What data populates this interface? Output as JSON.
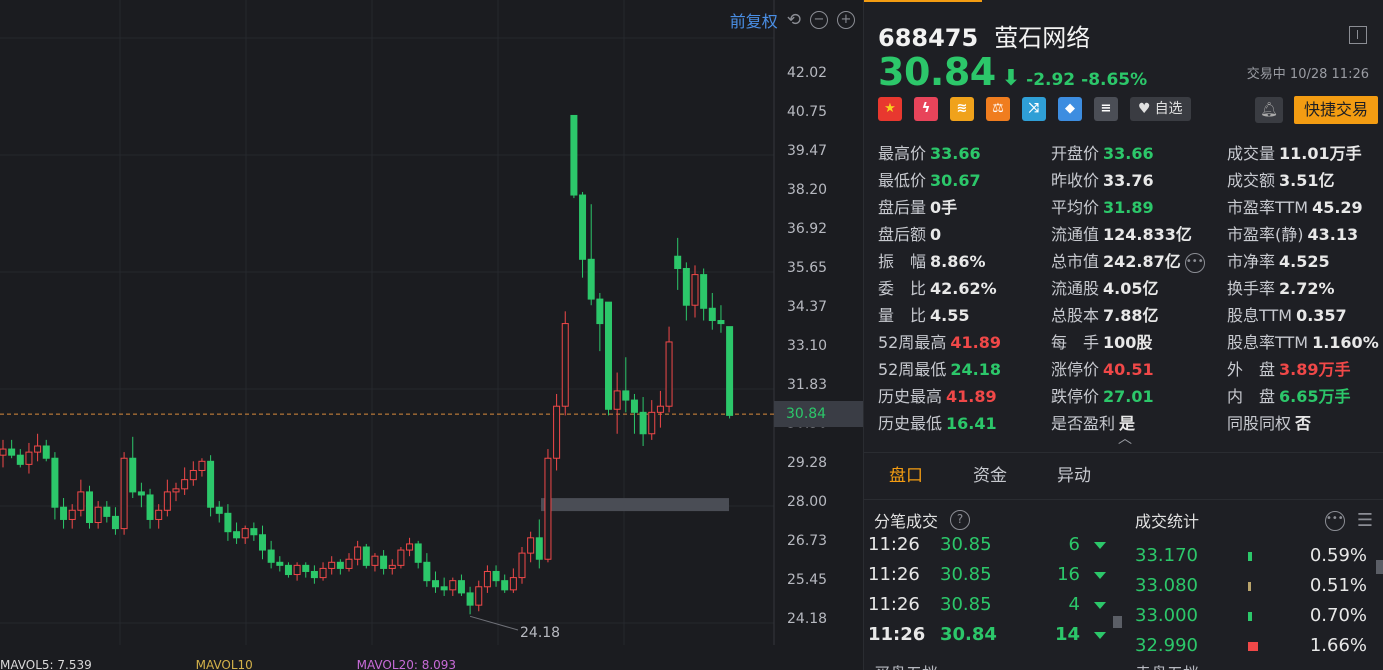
{
  "chart_toolbar": {
    "adjust_label": "前复权",
    "undo_glyph": "⟲",
    "zoom_out_glyph": "−",
    "zoom_in_glyph": "+"
  },
  "chart_data": {
    "type": "candlestick",
    "y_ticks": [
      "42.02",
      "40.75",
      "39.47",
      "38.20",
      "36.92",
      "35.65",
      "34.37",
      "33.10",
      "31.83",
      "30.56",
      "29.28",
      "28.00",
      "26.73",
      "25.45",
      "24.18"
    ],
    "ylim": [
      24.18,
      42.02
    ],
    "current_price": "30.84",
    "low_annotation": "24.18",
    "candles": [
      [
        29.5,
        30.0,
        29.1,
        29.7
      ],
      [
        29.7,
        30.0,
        29.4,
        29.5
      ],
      [
        29.5,
        29.7,
        29.1,
        29.2
      ],
      [
        29.2,
        29.9,
        28.9,
        29.6
      ],
      [
        29.6,
        30.2,
        29.3,
        29.8
      ],
      [
        29.8,
        30.0,
        29.3,
        29.4
      ],
      [
        29.4,
        29.6,
        27.4,
        27.8
      ],
      [
        27.8,
        28.1,
        27.1,
        27.4
      ],
      [
        27.4,
        27.9,
        27.1,
        27.7
      ],
      [
        27.7,
        28.7,
        27.5,
        28.3
      ],
      [
        28.3,
        28.5,
        27.1,
        27.3
      ],
      [
        27.3,
        28.0,
        27.1,
        27.8
      ],
      [
        27.8,
        28.0,
        27.3,
        27.5
      ],
      [
        27.5,
        27.8,
        26.9,
        27.1
      ],
      [
        27.1,
        29.6,
        26.9,
        29.4
      ],
      [
        29.4,
        30.1,
        28.1,
        28.3
      ],
      [
        28.3,
        28.6,
        27.8,
        28.2
      ],
      [
        28.2,
        28.4,
        27.1,
        27.4
      ],
      [
        27.4,
        27.9,
        27.1,
        27.7
      ],
      [
        27.7,
        28.7,
        27.5,
        28.3
      ],
      [
        28.3,
        28.6,
        28.0,
        28.4
      ],
      [
        28.4,
        29.1,
        28.2,
        28.7
      ],
      [
        28.7,
        29.3,
        28.5,
        29.0
      ],
      [
        29.0,
        29.4,
        28.8,
        29.3
      ],
      [
        29.3,
        29.5,
        27.5,
        27.8
      ],
      [
        27.8,
        28.0,
        27.3,
        27.6
      ],
      [
        27.6,
        27.9,
        26.7,
        27.0
      ],
      [
        27.0,
        27.3,
        26.6,
        26.8
      ],
      [
        26.8,
        27.2,
        26.6,
        27.1
      ],
      [
        27.1,
        27.3,
        26.7,
        26.9
      ],
      [
        26.9,
        27.2,
        26.1,
        26.4
      ],
      [
        26.4,
        26.7,
        25.8,
        26.0
      ],
      [
        26.0,
        26.2,
        25.7,
        25.9
      ],
      [
        25.9,
        26.0,
        25.5,
        25.6
      ],
      [
        25.6,
        26.0,
        25.4,
        25.9
      ],
      [
        25.9,
        26.0,
        25.5,
        25.7
      ],
      [
        25.7,
        25.9,
        25.3,
        25.5
      ],
      [
        25.5,
        26.0,
        25.4,
        25.8
      ],
      [
        25.8,
        26.2,
        25.6,
        26.0
      ],
      [
        26.0,
        26.1,
        25.6,
        25.8
      ],
      [
        25.8,
        26.3,
        25.7,
        26.1
      ],
      [
        26.1,
        26.7,
        25.9,
        26.5
      ],
      [
        26.5,
        26.6,
        25.8,
        25.9
      ],
      [
        25.9,
        26.3,
        25.7,
        26.2
      ],
      [
        26.2,
        26.4,
        25.6,
        25.8
      ],
      [
        25.8,
        26.1,
        25.6,
        25.9
      ],
      [
        25.9,
        26.5,
        25.8,
        26.4
      ],
      [
        26.4,
        26.8,
        26.2,
        26.6
      ],
      [
        26.6,
        26.7,
        25.8,
        26.0
      ],
      [
        26.0,
        26.3,
        25.2,
        25.4
      ],
      [
        25.4,
        25.7,
        25.0,
        25.2
      ],
      [
        25.2,
        25.5,
        24.9,
        25.1
      ],
      [
        25.1,
        25.5,
        24.9,
        25.4
      ],
      [
        25.4,
        25.6,
        24.9,
        25.0
      ],
      [
        25.0,
        25.2,
        24.3,
        24.6
      ],
      [
        24.6,
        25.4,
        24.4,
        25.2
      ],
      [
        25.2,
        25.9,
        25.0,
        25.7
      ],
      [
        25.7,
        25.9,
        25.2,
        25.4
      ],
      [
        25.4,
        25.6,
        25.0,
        25.1
      ],
      [
        25.1,
        25.8,
        25.0,
        25.5
      ],
      [
        25.5,
        26.5,
        25.3,
        26.3
      ],
      [
        26.3,
        27.0,
        26.0,
        26.8
      ],
      [
        26.8,
        27.4,
        25.8,
        26.1
      ],
      [
        26.1,
        29.7,
        26.0,
        29.4
      ],
      [
        29.4,
        31.5,
        29.0,
        31.1
      ],
      [
        31.1,
        34.2,
        30.8,
        33.8
      ],
      [
        40.6,
        40.6,
        37.9,
        38.0
      ],
      [
        38.0,
        38.1,
        35.3,
        35.9
      ],
      [
        35.9,
        37.7,
        34.4,
        34.6
      ],
      [
        34.6,
        34.8,
        32.9,
        33.8
      ],
      [
        34.5,
        34.5,
        30.8,
        31.0
      ],
      [
        31.0,
        32.2,
        30.2,
        31.6
      ],
      [
        31.6,
        32.7,
        30.9,
        31.3
      ],
      [
        31.3,
        31.5,
        30.2,
        30.9
      ],
      [
        30.9,
        31.4,
        29.8,
        30.2
      ],
      [
        30.2,
        31.3,
        30.0,
        30.9
      ],
      [
        30.9,
        31.6,
        30.4,
        31.1
      ],
      [
        31.1,
        33.7,
        30.9,
        33.2
      ],
      [
        36.0,
        36.6,
        34.9,
        35.6
      ],
      [
        35.6,
        35.8,
        33.9,
        34.4
      ],
      [
        34.4,
        35.7,
        34.0,
        35.4
      ],
      [
        35.4,
        35.6,
        33.9,
        34.3
      ],
      [
        34.3,
        34.8,
        33.6,
        33.9
      ],
      [
        33.9,
        34.4,
        33.5,
        33.8
      ],
      [
        33.7,
        33.7,
        30.7,
        30.8
      ]
    ]
  },
  "volume_legend": [
    "MAVOL5: 7.539",
    "MAVOL10",
    "MAVOL20: 8.093"
  ],
  "header": {
    "code": "688475",
    "name": "萤石网络",
    "price": "30.84",
    "arrow": "⬇",
    "change": "-2.92",
    "change_pct": "-8.65%",
    "status_time": "交易中 10/28 11:26"
  },
  "badges": [
    {
      "icon": "china-flag-icon",
      "glyph": "★",
      "color": "#e8382f"
    },
    {
      "icon": "flash-icon",
      "glyph": "ϟ",
      "color": "#e8445a"
    },
    {
      "icon": "coins-icon",
      "glyph": "≋",
      "color": "#f0a21b"
    },
    {
      "icon": "balance-icon",
      "glyph": "⚖",
      "color": "#f07d1f"
    },
    {
      "icon": "shuffle-icon",
      "glyph": "⤨",
      "color": "#2f9fd6"
    },
    {
      "icon": "tag-icon",
      "glyph": "◆",
      "color": "#3d8de0"
    },
    {
      "icon": "document-icon",
      "glyph": "≡",
      "color": "#6b6e76"
    }
  ],
  "watchlist_label": "自选",
  "trade_label": "快捷交易",
  "fields_col1": [
    {
      "k": "最高价",
      "v": "33.66",
      "c": "g"
    },
    {
      "k": "最低价",
      "v": "30.67",
      "c": "g"
    },
    {
      "k": "盘后量",
      "v": "0手",
      "c": "w"
    },
    {
      "k": "盘后额",
      "v": "0",
      "c": "w"
    },
    {
      "k": "振　幅",
      "v": "8.86%",
      "c": "w"
    },
    {
      "k": "委　比",
      "v": "42.62%",
      "c": "w"
    },
    {
      "k": "量　比",
      "v": "4.55",
      "c": "w"
    },
    {
      "k": "52周最高",
      "v": "41.89",
      "c": "r"
    },
    {
      "k": "52周最低",
      "v": "24.18",
      "c": "g"
    },
    {
      "k": "历史最高",
      "v": "41.89",
      "c": "r"
    },
    {
      "k": "历史最低",
      "v": "16.41",
      "c": "g"
    }
  ],
  "fields_col2": [
    {
      "k": "开盘价",
      "v": "33.66",
      "c": "g"
    },
    {
      "k": "昨收价",
      "v": "33.76",
      "c": "w"
    },
    {
      "k": "平均价",
      "v": "31.89",
      "c": "g"
    },
    {
      "k": "流通值",
      "v": "124.833亿",
      "c": "w"
    },
    {
      "k": "总市值",
      "v": "242.87亿",
      "c": "w"
    },
    {
      "k": "流通股",
      "v": "4.05亿",
      "c": "w"
    },
    {
      "k": "总股本",
      "v": "7.88亿",
      "c": "w"
    },
    {
      "k": "每　手",
      "v": "100股",
      "c": "w"
    },
    {
      "k": "涨停价",
      "v": "40.51",
      "c": "r"
    },
    {
      "k": "跌停价",
      "v": "27.01",
      "c": "g"
    },
    {
      "k": "是否盈利",
      "v": "是",
      "c": "w"
    }
  ],
  "fields_col3": [
    {
      "k": "成交量",
      "v": "11.01万手",
      "c": "w"
    },
    {
      "k": "成交额",
      "v": "3.51亿",
      "c": "w"
    },
    {
      "k": "市盈率TTM",
      "v": "45.29",
      "c": "w"
    },
    {
      "k": "市盈率(静)",
      "v": "43.13",
      "c": "w"
    },
    {
      "k": "市净率",
      "v": "4.525",
      "c": "w"
    },
    {
      "k": "换手率",
      "v": "2.72%",
      "c": "w"
    },
    {
      "k": "股息TTM",
      "v": "0.357",
      "c": "w"
    },
    {
      "k": "股息率TTM",
      "v": "1.160%",
      "c": "w"
    },
    {
      "k": "外　盘",
      "v": "3.89万手",
      "c": "r"
    },
    {
      "k": "内　盘",
      "v": "6.65万手",
      "c": "g"
    },
    {
      "k": "同股同权",
      "v": "否",
      "c": "w"
    }
  ],
  "tabs": [
    "盘口",
    "资金",
    "异动"
  ],
  "ticks_title": "分笔成交",
  "ticks": [
    {
      "time": "11:26",
      "price": "30.85",
      "qty": "6",
      "bold": false
    },
    {
      "time": "11:26",
      "price": "30.85",
      "qty": "16",
      "bold": false
    },
    {
      "time": "11:26",
      "price": "30.85",
      "qty": "4",
      "bold": false
    },
    {
      "time": "11:26",
      "price": "30.84",
      "qty": "14",
      "bold": true
    }
  ],
  "stats_title": "成交统计",
  "stats": [
    {
      "price": "33.170",
      "pct": "0.59%",
      "share": 0.0059,
      "color": "#2cc76a"
    },
    {
      "price": "33.080",
      "pct": "0.51%",
      "share": 0.0051,
      "color": "#b9a36b"
    },
    {
      "price": "33.000",
      "pct": "0.70%",
      "share": 0.007,
      "color": "#2cc76a"
    },
    {
      "price": "32.990",
      "pct": "1.66%",
      "share": 0.0166,
      "color": "#f04848"
    }
  ],
  "bottom_labels": [
    "买盘五档",
    "卖盘五档"
  ]
}
